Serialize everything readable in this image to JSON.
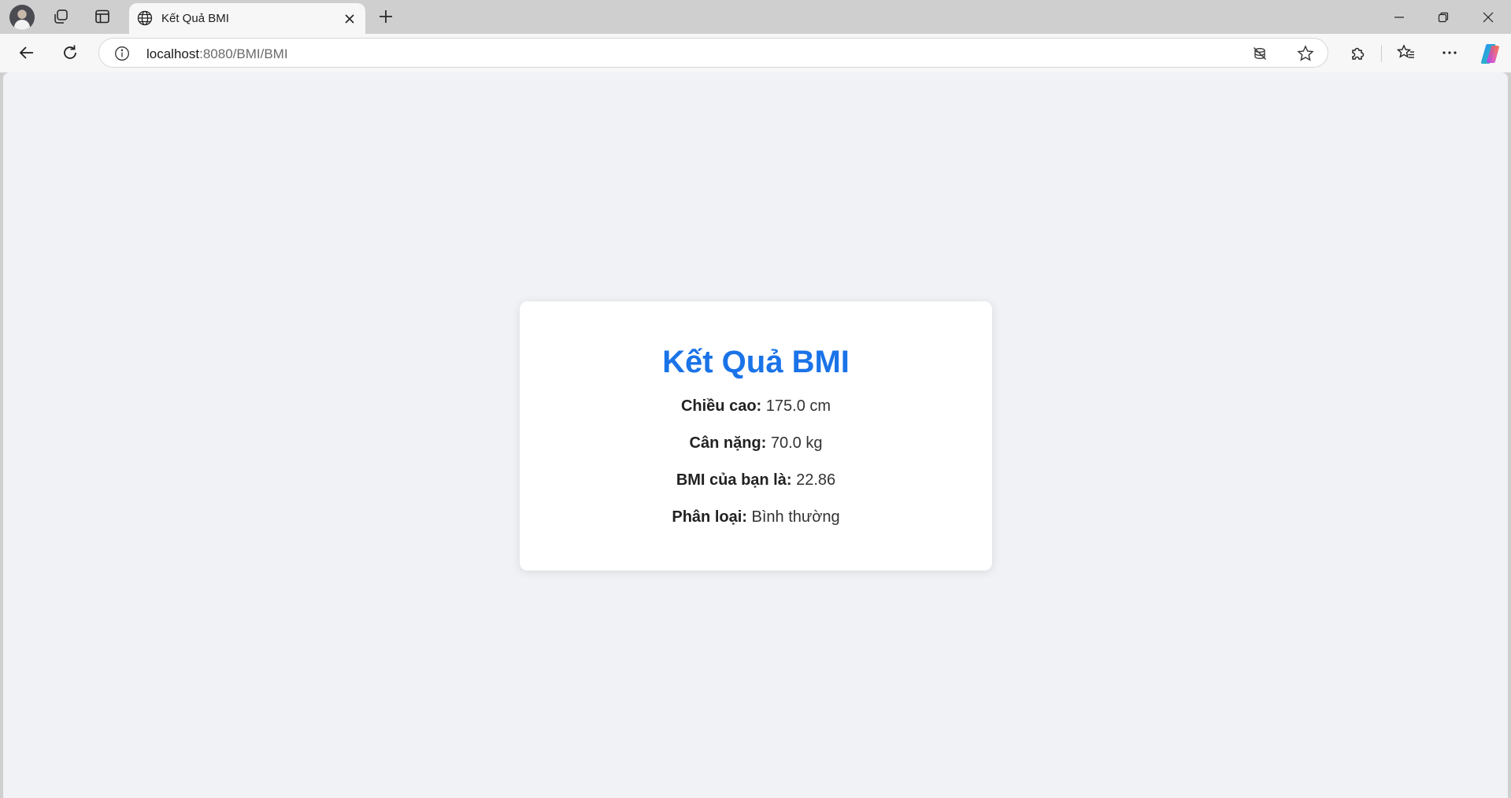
{
  "browser": {
    "tab": {
      "title": "Kết Quả BMI"
    },
    "address": {
      "host": "localhost",
      "path": ":8080/BMI/BMI"
    },
    "icons": {
      "profile": "avatar",
      "workspaces": "workspaces-icon",
      "tab_actions": "vertical-tabs-icon",
      "favicon": "globe-icon",
      "close_tab": "close-icon",
      "new_tab": "plus-icon",
      "back": "back-arrow-icon",
      "reload": "reload-icon",
      "site_info": "info-icon",
      "tracking": "tracking-prevention-icon",
      "favorite": "star-icon",
      "extensions": "puzzle-icon",
      "favorites": "favorites-list-icon",
      "more": "more-icon",
      "copilot": "copilot-icon"
    }
  },
  "page": {
    "title": "Kết Quả BMI",
    "results": [
      {
        "label": "Chiều cao:",
        "value": "175.0 cm"
      },
      {
        "label": "Cân nặng:",
        "value": "70.0 kg"
      },
      {
        "label": "BMI của bạn là:",
        "value": "22.86"
      },
      {
        "label": "Phân loại:",
        "value": "Bình thường"
      }
    ]
  },
  "colors": {
    "title": "#1a73e8",
    "page_background": "#f0f2f5",
    "card_background": "#ffffff",
    "chrome_background": "#cfcfcf",
    "toolbar_background": "#f7f7f7"
  }
}
